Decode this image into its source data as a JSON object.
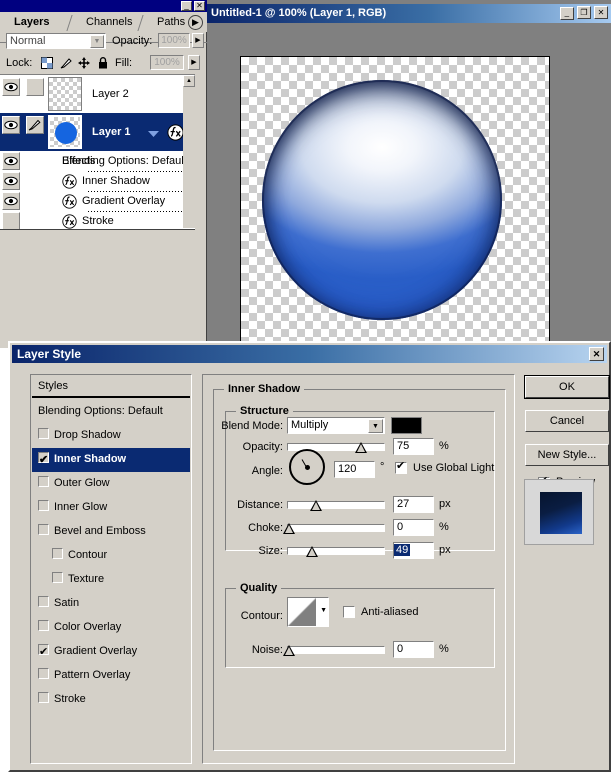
{
  "layers_panel": {
    "tabs": [
      {
        "label": "Layers",
        "active": true
      },
      {
        "label": "Channels",
        "active": false
      },
      {
        "label": "Paths",
        "active": false
      }
    ],
    "menu_arrow_icon": "triangle-right-icon",
    "titlebar": {
      "minimize_label": "_",
      "close_label": "✕"
    },
    "blend_mode": {
      "value": "Normal",
      "arrow_icon": "chevron-down-icon"
    },
    "opacity": {
      "label": "Opacity:",
      "value": "100%",
      "arrow_icon": "triangle-right-icon"
    },
    "lock": {
      "label": "Lock:",
      "icons": [
        "transparency-lock-icon",
        "brush-lock-icon",
        "move-lock-icon",
        "lock-all-icon"
      ]
    },
    "fill": {
      "label": "Fill:",
      "value": "100%",
      "arrow_icon": "triangle-right-icon"
    },
    "layers": [
      {
        "name": "Layer 2",
        "visible": true,
        "selected": false,
        "active_brush": false
      },
      {
        "name": "Layer 1",
        "visible": true,
        "selected": true,
        "active_brush": true,
        "collapse_icon": "triangle-down-icon",
        "fx_icon": "fx-icon"
      }
    ],
    "effects": {
      "header": "Effects",
      "items": [
        {
          "label": "Inner Shadow",
          "visible": true
        },
        {
          "label": "Gradient Overlay",
          "visible": true
        },
        {
          "label": "Stroke",
          "visible": true
        }
      ]
    },
    "scrollbar": {
      "up_icon": "triangle-up-icon",
      "down_icon": "triangle-down-icon"
    }
  },
  "document_window": {
    "title": "Untitled-1 @ 100% (Layer 1, RGB)",
    "controls": [
      {
        "icon": "minimize-icon",
        "glyph": "_"
      },
      {
        "icon": "maximize-icon",
        "glyph": "❐"
      },
      {
        "icon": "close-icon",
        "glyph": "✕"
      }
    ],
    "canvas": {
      "artwork": "glossy-blue-sphere",
      "background": "transparency-checkerboard"
    }
  },
  "layer_style_dialog": {
    "title": "Layer Style",
    "close_glyph": "✕",
    "styles": {
      "header": "Styles",
      "items": [
        {
          "label": "Blending Options: Default",
          "checkbox": false,
          "checked": false,
          "selected": false,
          "indent": false
        },
        {
          "label": "Drop Shadow",
          "checkbox": true,
          "checked": false,
          "selected": false,
          "indent": false
        },
        {
          "label": "Inner Shadow",
          "checkbox": true,
          "checked": true,
          "selected": true,
          "indent": false
        },
        {
          "label": "Outer Glow",
          "checkbox": true,
          "checked": false,
          "selected": false,
          "indent": false
        },
        {
          "label": "Inner Glow",
          "checkbox": true,
          "checked": false,
          "selected": false,
          "indent": false
        },
        {
          "label": "Bevel and Emboss",
          "checkbox": true,
          "checked": false,
          "selected": false,
          "indent": false
        },
        {
          "label": "Contour",
          "checkbox": true,
          "checked": false,
          "selected": false,
          "indent": true
        },
        {
          "label": "Texture",
          "checkbox": true,
          "checked": false,
          "selected": false,
          "indent": true
        },
        {
          "label": "Satin",
          "checkbox": true,
          "checked": false,
          "selected": false,
          "indent": false
        },
        {
          "label": "Color Overlay",
          "checkbox": true,
          "checked": false,
          "selected": false,
          "indent": false
        },
        {
          "label": "Gradient Overlay",
          "checkbox": true,
          "checked": true,
          "selected": false,
          "indent": false
        },
        {
          "label": "Pattern Overlay",
          "checkbox": true,
          "checked": false,
          "selected": false,
          "indent": false
        },
        {
          "label": "Stroke",
          "checkbox": true,
          "checked": false,
          "selected": false,
          "indent": false
        }
      ]
    },
    "panel_title": "Inner Shadow",
    "structure": {
      "title": "Structure",
      "blend_mode": {
        "label": "Blend Mode:",
        "value": "Multiply",
        "arrow_icon": "chevron-down-icon",
        "color": "#000000"
      },
      "opacity": {
        "label": "Opacity:",
        "value": "75",
        "unit": "%",
        "percent": 75
      },
      "angle": {
        "label": "Angle:",
        "value": "120",
        "unit": "°",
        "degrees": 120,
        "global_light": {
          "label": "Use Global Light",
          "checked": true
        }
      },
      "distance": {
        "label": "Distance:",
        "value": "27",
        "unit": "px",
        "percent": 27
      },
      "choke": {
        "label": "Choke:",
        "value": "0",
        "unit": "%",
        "percent": 0
      },
      "size": {
        "label": "Size:",
        "value": "49",
        "unit": "px",
        "percent": 25,
        "selected_text": true
      }
    },
    "quality": {
      "title": "Quality",
      "contour": {
        "label": "Contour:",
        "arrow_icon": "chevron-down-icon",
        "preset": "linear-contour"
      },
      "anti_aliased": {
        "label": "Anti-aliased",
        "checked": false
      },
      "noise": {
        "label": "Noise:",
        "value": "0",
        "unit": "%",
        "percent": 0
      }
    },
    "buttons": {
      "ok": "OK",
      "cancel": "Cancel",
      "new_style": "New Style...",
      "preview": {
        "label": "Preview",
        "checked": true
      }
    }
  }
}
